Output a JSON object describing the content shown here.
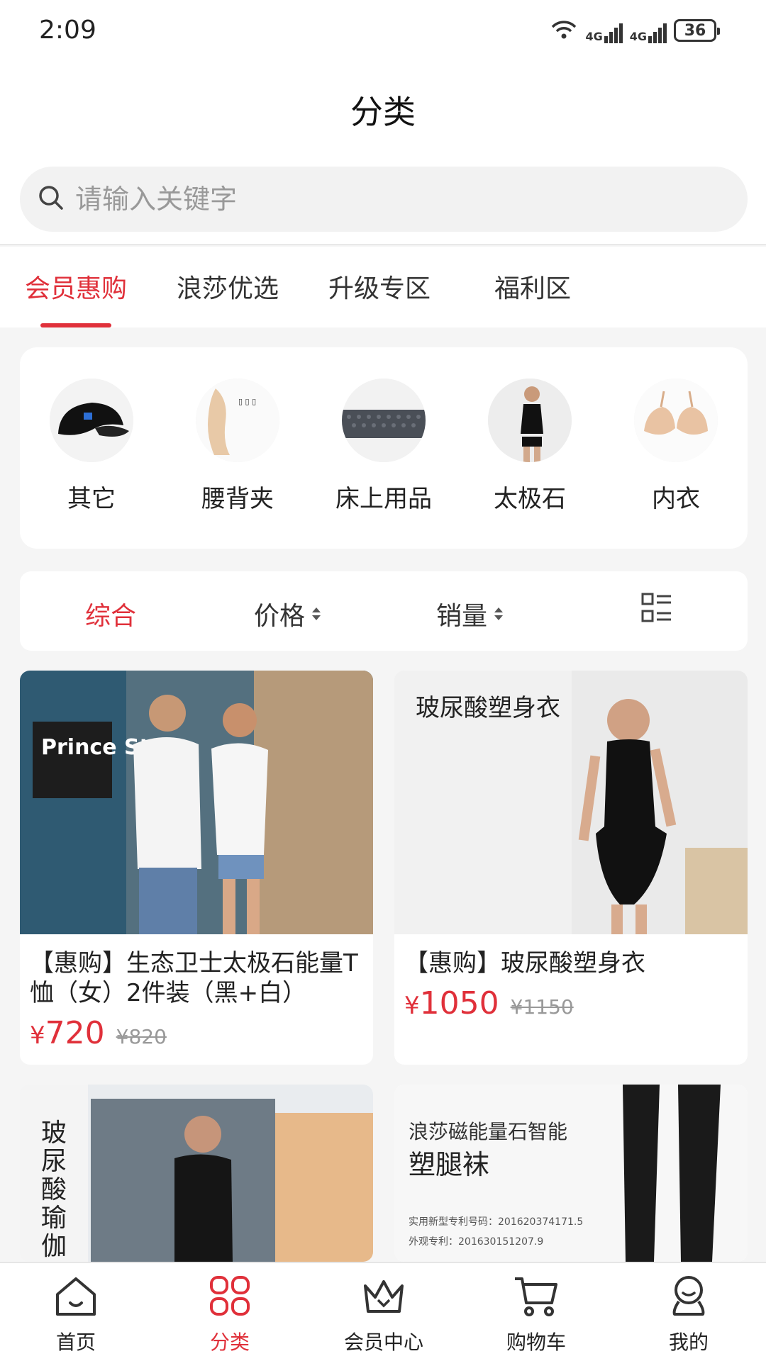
{
  "status": {
    "time": "2:09",
    "battery": "36",
    "net1": "4G",
    "net2": "4G",
    "wifi_label": "6"
  },
  "header": {
    "title": "分类"
  },
  "search": {
    "placeholder": "请输入关键字"
  },
  "tabs": [
    {
      "label": "会员惠购",
      "active": true
    },
    {
      "label": "浪莎优选",
      "active": false
    },
    {
      "label": "升级专区",
      "active": false
    },
    {
      "label": "福利区",
      "active": false
    }
  ],
  "categories": [
    {
      "label": "其它",
      "icon": "cap-image"
    },
    {
      "label": "腰背夹",
      "icon": "waist-belt-image"
    },
    {
      "label": "床上用品",
      "icon": "mattress-image"
    },
    {
      "label": "太极石",
      "icon": "tank-top-image"
    },
    {
      "label": "内衣",
      "icon": "bra-image"
    }
  ],
  "sort": {
    "comprehensive": "综合",
    "price": "价格",
    "sales": "销量",
    "layout_icon": "list-layout-icon"
  },
  "products": [
    {
      "title": "【惠购】生态卫士太极石能量T恤（女）2件装（黑+白）",
      "price_symbol": "¥",
      "price": "720",
      "old_price": "¥820",
      "image_text": "Prince St"
    },
    {
      "title": "【惠购】玻尿酸塑身衣",
      "price_symbol": "¥",
      "price": "1050",
      "old_price": "¥1150",
      "image_text": "玻尿酸塑身衣"
    },
    {
      "image_text": "玻尿酸瑜伽"
    },
    {
      "image_text_line1": "浪莎磁能量石智能",
      "image_text_line2": "塑腿袜",
      "image_text_line3": "实用新型专利号码：201620374171.5",
      "image_text_line4": "外观专利：201630151207.9"
    }
  ],
  "tabbar": [
    {
      "label": "首页",
      "icon": "home-icon",
      "active": false
    },
    {
      "label": "分类",
      "icon": "category-grid-icon",
      "active": true
    },
    {
      "label": "会员中心",
      "icon": "crown-icon",
      "active": false
    },
    {
      "label": "购物车",
      "icon": "cart-icon",
      "active": false
    },
    {
      "label": "我的",
      "icon": "user-icon",
      "active": false
    }
  ],
  "colors": {
    "accent": "#e0303a",
    "background": "#f5f5f5"
  }
}
